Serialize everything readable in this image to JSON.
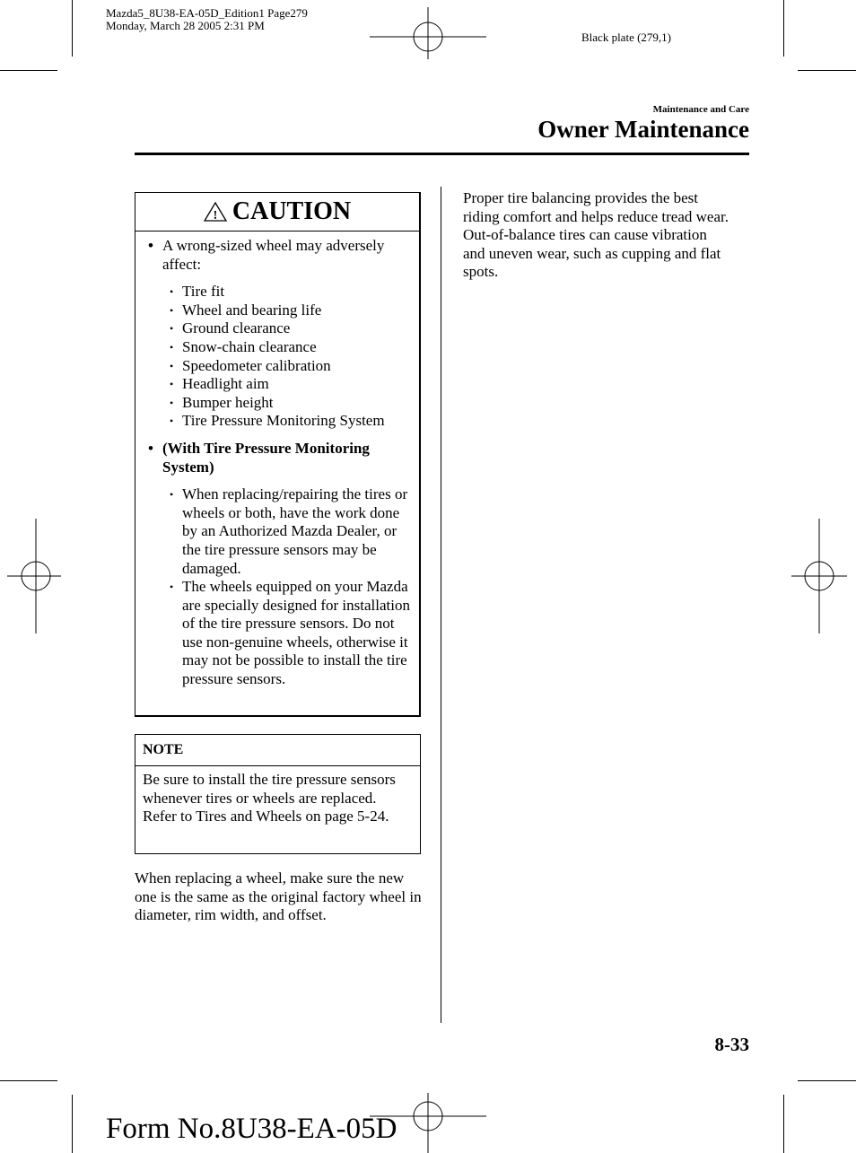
{
  "print_header": {
    "file_line": "Mazda5_8U38-EA-05D_Edition1 Page279",
    "date_line": "Monday, March 28 2005 2:31 PM",
    "plate": "Black plate (279,1)"
  },
  "header": {
    "section": "Maintenance and Care",
    "title": "Owner Maintenance"
  },
  "caution": {
    "icon": "warning-triangle-icon",
    "heading": "CAUTION",
    "items": [
      {
        "text": "A wrong-sized wheel may adversely affect:",
        "bold": false,
        "subitems": [
          "Tire fit",
          "Wheel and bearing life",
          "Ground clearance",
          "Snow-chain clearance",
          "Speedometer calibration",
          "Headlight aim",
          "Bumper height",
          "Tire Pressure Monitoring System"
        ]
      },
      {
        "text": "(With Tire Pressure Monitoring System)",
        "bold": true,
        "subitems": [
          "When replacing/repairing the tires or wheels or both, have the work done by an Authorized Mazda Dealer, or the tire pressure sensors may be damaged.",
          "The wheels equipped on your Mazda are specially designed for installation of the tire pressure sensors. Do not use non-genuine wheels, otherwise it may not be possible to install the tire pressure sensors."
        ]
      }
    ]
  },
  "note": {
    "heading": "NOTE",
    "body": "Be sure to install the tire pressure sensors whenever tires or wheels are replaced. Refer to Tires and Wheels on page 5-24."
  },
  "left_paragraph": "When replacing a wheel, make sure the new one is the same as the original factory wheel in diameter, rim width, and offset.",
  "right_paragraph": "Proper tire balancing provides the best riding comfort and helps reduce tread wear. Out-of-balance tires can cause vibration and uneven wear, such as cupping and flat spots.",
  "page_number": "8-33",
  "form_number": "Form No.8U38-EA-05D"
}
